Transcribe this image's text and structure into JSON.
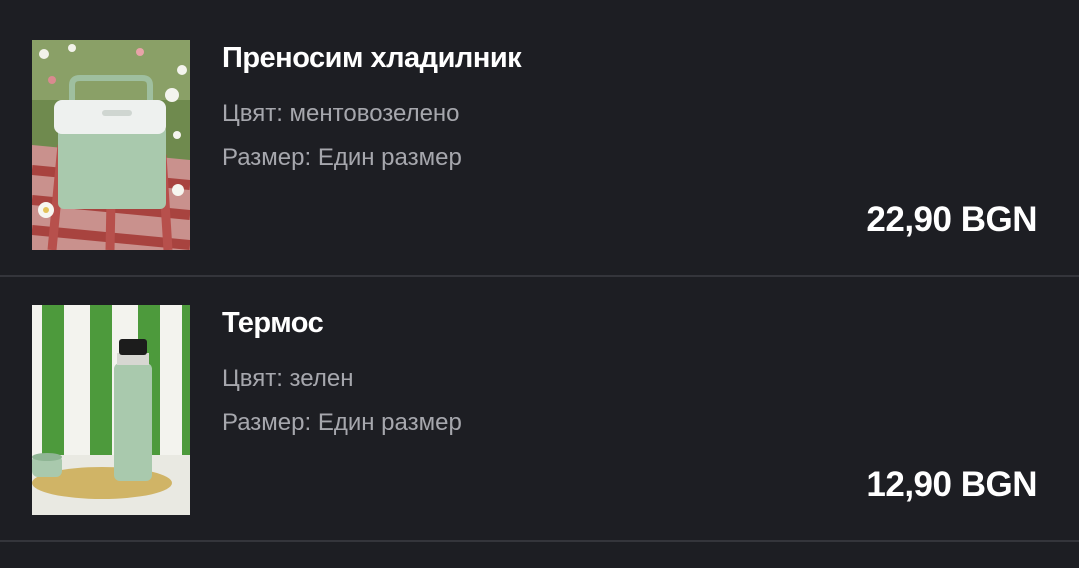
{
  "cart_items": [
    {
      "title": "Преносим хладилник",
      "color_text": "Цвят: ментовозелено",
      "size_text": "Размер: Един размер",
      "price": "22,90 BGN",
      "image_icon": "cooler-product-image"
    },
    {
      "title": "Термос",
      "color_text": "Цвят: зелен",
      "size_text": "Размер: Един размер",
      "price": "12,90 BGN",
      "image_icon": "thermos-product-image"
    }
  ],
  "colors": {
    "background": "#1d1e23",
    "divider": "#34353b",
    "title": "#ffffff",
    "meta": "#a6a7ad",
    "mint": "#a9c9ad"
  }
}
